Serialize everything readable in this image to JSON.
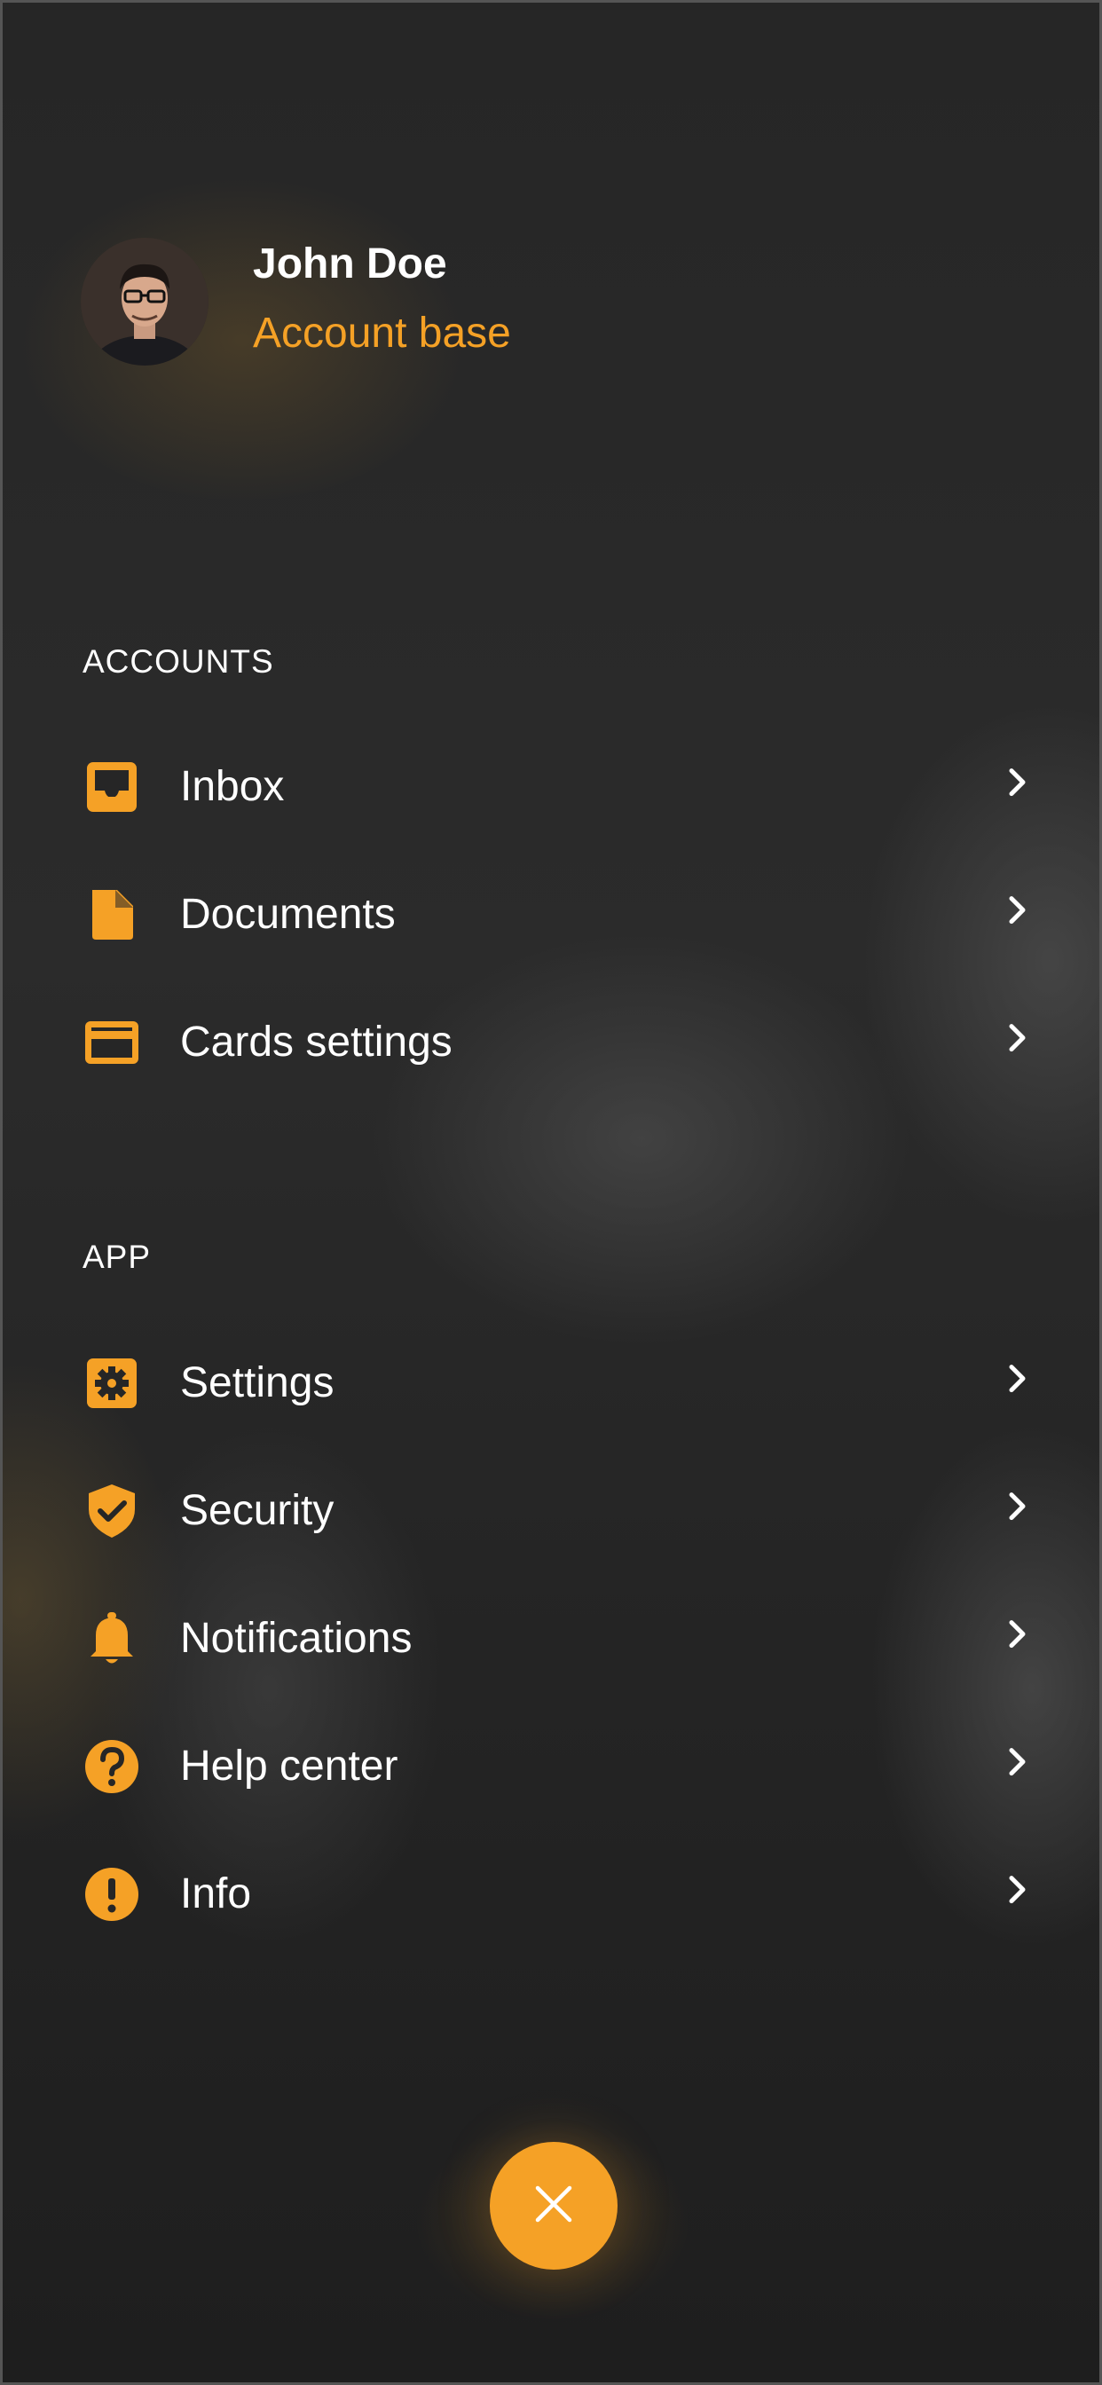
{
  "profile": {
    "name": "John Doe",
    "subtitle": "Account base"
  },
  "sections": {
    "accounts": {
      "title": "ACCOUNTS",
      "items": [
        {
          "label": "Inbox",
          "icon": "inbox-icon"
        },
        {
          "label": "Documents",
          "icon": "document-icon"
        },
        {
          "label": "Cards settings",
          "icon": "credit-card-icon"
        }
      ]
    },
    "app": {
      "title": "APP",
      "items": [
        {
          "label": "Settings",
          "icon": "gear-icon"
        },
        {
          "label": "Security",
          "icon": "shield-check-icon"
        },
        {
          "label": "Notifications",
          "icon": "bell-icon"
        },
        {
          "label": "Help center",
          "icon": "help-circle-icon"
        },
        {
          "label": "Info",
          "icon": "alert-circle-icon"
        }
      ]
    }
  },
  "colors": {
    "accent": "#f5a126",
    "background": "#222222",
    "text": "#ffffff"
  },
  "fab": {
    "icon": "close-icon"
  }
}
